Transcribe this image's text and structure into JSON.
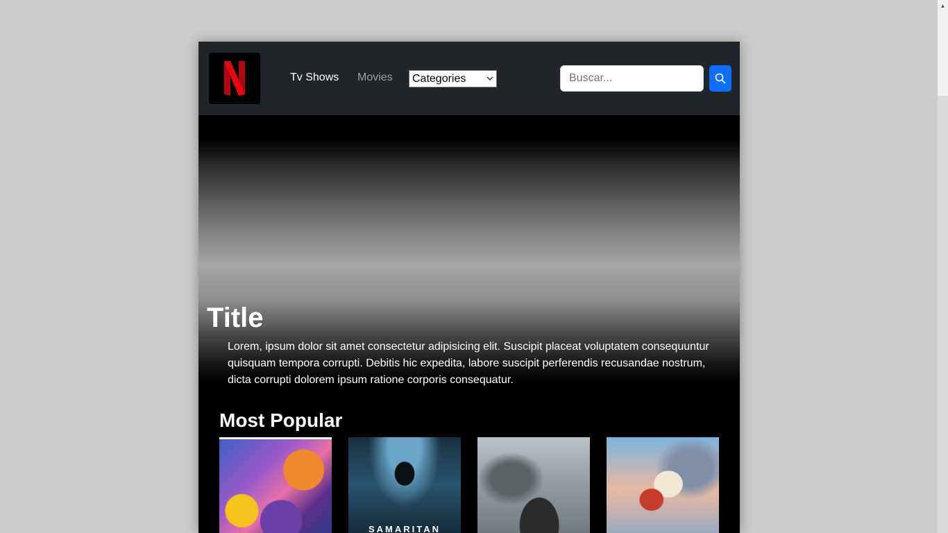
{
  "navbar": {
    "logo_alt": "N",
    "links": [
      {
        "label": "Tv Shows"
      },
      {
        "label": "Movies"
      }
    ],
    "category_select": {
      "selected": "Categories"
    },
    "search": {
      "placeholder": "Buscar..."
    }
  },
  "hero": {
    "title": "Title",
    "description": "Lorem, ipsum dolor sit amet consectetur adipisicing elit. Suscipit placeat voluptatem consequuntur quisquam tempora corrupti. Debitis hic expedita, labore suscipit perferendis recusandae nostrum, dicta corrupti dolorem ipsum ratione corporis consequatur."
  },
  "most_popular": {
    "title": "Most Popular",
    "posters": [
      {
        "caption": ""
      },
      {
        "caption": "SAMARITAN"
      },
      {
        "caption": ""
      },
      {
        "caption": ""
      }
    ]
  },
  "colors": {
    "navbar_bg": "#212529",
    "brand_red": "#e50914",
    "search_button": "#0d6efd",
    "page_bg": "#cdcdcd"
  }
}
